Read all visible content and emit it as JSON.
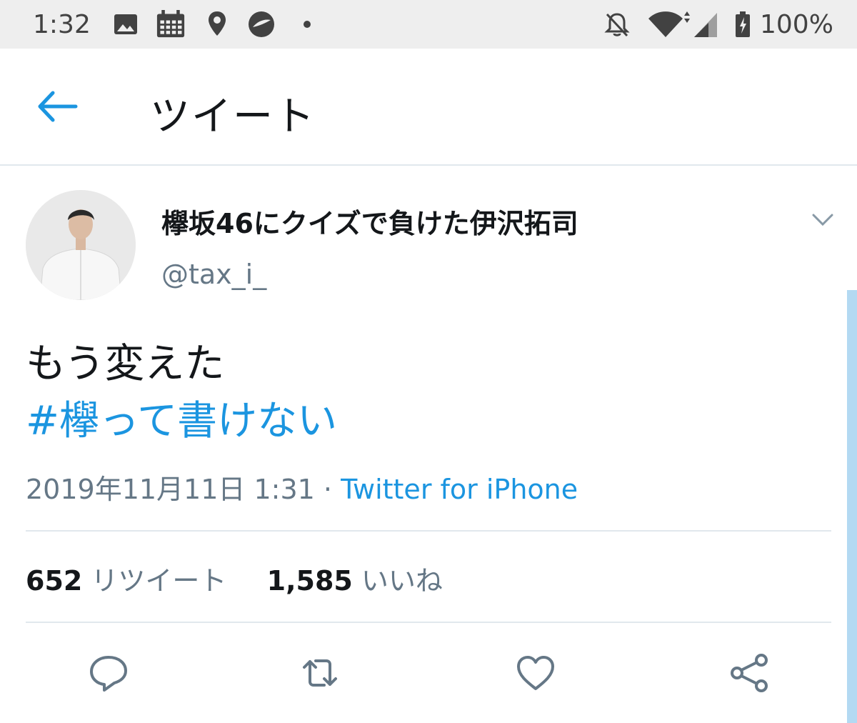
{
  "status_bar": {
    "time": "1:32",
    "icons": [
      "image-icon",
      "calendar-icon",
      "location-icon",
      "app-icon",
      "dot-icon",
      "notifications-off-icon",
      "wifi-icon",
      "signal-icon",
      "battery-icon"
    ],
    "battery": "100%"
  },
  "header": {
    "back_icon": "arrow-left-icon",
    "title": "ツイート"
  },
  "tweet": {
    "display_name": "欅坂46にクイズで負けた伊沢拓司",
    "handle": "@tax_i_",
    "text_line1": "もう変えた",
    "hashtag": "#欅って書けない",
    "timestamp": "2019年11月11日 1:31",
    "separator": " · ",
    "source": "Twitter for iPhone",
    "retweet_count": "652",
    "retweet_label": "リツイート",
    "like_count": "1,585",
    "like_label": "いいね"
  },
  "actions": [
    "reply-icon",
    "retweet-icon",
    "like-icon",
    "share-icon"
  ],
  "colors": {
    "accent": "#1b95e0",
    "text": "#14171a",
    "secondary": "#657786",
    "divider": "#e1e8ed",
    "status_bar_bg": "#eeeeee"
  }
}
